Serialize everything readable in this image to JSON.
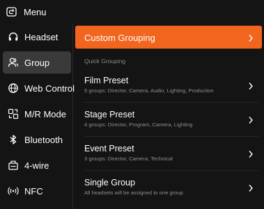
{
  "header": {
    "title": "Menu"
  },
  "sidebar": {
    "items": [
      {
        "label": "Headset",
        "icon": "headset-icon"
      },
      {
        "label": "Group",
        "icon": "group-icon",
        "active": true
      },
      {
        "label": "Web Control",
        "icon": "globe-icon"
      },
      {
        "label": "M/R Mode",
        "icon": "mr-mode-icon"
      },
      {
        "label": "Bluetooth",
        "icon": "bluetooth-icon"
      },
      {
        "label": "4-wire",
        "icon": "four-wire-icon"
      },
      {
        "label": "NFC",
        "icon": "nfc-icon"
      }
    ]
  },
  "main": {
    "custom_grouping": {
      "label": "Custom Grouping"
    },
    "section_label": "Quick Grouping",
    "presets": [
      {
        "title": "Film Preset",
        "desc": "5 groups: Director, Camera, Audio, Lighting, Production"
      },
      {
        "title": "Stage Preset",
        "desc": "4 groups: Director, Program, Camera, Lighting"
      },
      {
        "title": "Event Preset",
        "desc": "3 groups: Director, Camera, Technical"
      },
      {
        "title": "Single Group",
        "desc": "All headsets will be assigned to one group"
      }
    ]
  },
  "colors": {
    "accent": "#f2651f",
    "background": "#141414",
    "active_item": "#3a3a3a"
  }
}
